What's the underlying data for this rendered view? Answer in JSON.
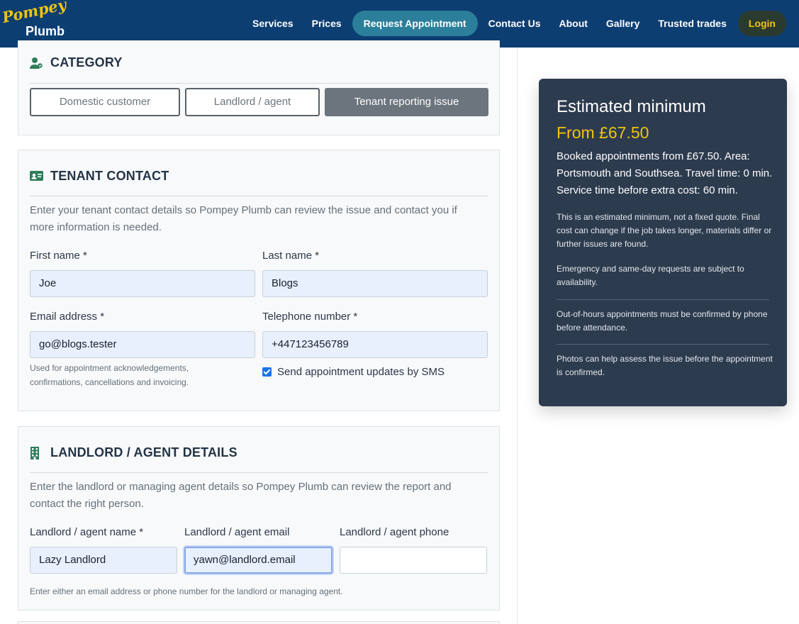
{
  "brand": {
    "logo_script": "Pompey",
    "logo_word": "Plumb"
  },
  "nav": {
    "services": "Services",
    "prices": "Prices",
    "request": "Request Appointment",
    "contact": "Contact Us",
    "about": "About",
    "gallery": "Gallery",
    "trusted": "Trusted trades",
    "login": "Login"
  },
  "category": {
    "title": "CATEGORY",
    "options": [
      "Domestic customer",
      "Landlord / agent",
      "Tenant reporting issue"
    ],
    "selected": "Tenant reporting issue"
  },
  "tenant": {
    "title": "TENANT CONTACT",
    "description": "Enter your tenant contact details so Pompey Plumb can review the issue and contact you if more information is needed.",
    "first_name_label": "First name *",
    "first_name": "Joe",
    "last_name_label": "Last name *",
    "last_name": "Blogs",
    "email_label": "Email address *",
    "email": "go@blogs.tester",
    "email_help": "Used for appointment acknowledgements, confirmations, cancellations and invoicing.",
    "phone_label": "Telephone number *",
    "phone": "+447123456789",
    "sms_label": "Send appointment updates by SMS",
    "sms_checked": true
  },
  "landlord": {
    "title": "LANDLORD / AGENT DETAILS",
    "description": "Enter the landlord or managing agent details so Pompey Plumb can review the report and contact the right person.",
    "name_label": "Landlord / agent name *",
    "name": "Lazy Landlord",
    "email_label": "Landlord / agent email",
    "email": "yawn@landlord.email",
    "phone_label": "Landlord / agent phone",
    "phone": "",
    "help": "Enter either an email address or phone number for the landlord or managing agent."
  },
  "estimate": {
    "heading": "Estimated minimum",
    "price": "From £67.50",
    "lead": "Booked appointments from £67.50. Area: Portsmouth and Southsea. Travel time: 0 min. Service time before extra cost: 60 min.",
    "note1": "This is an estimated minimum, not a fixed quote. Final cost can change if the job takes longer, materials differ or further issues are found.",
    "note2": "Emergency and same-day requests are subject to availability.",
    "note3": "Out-of-hours appointments must be confirmed by phone before attendance.",
    "note4": "Photos can help assess the issue before the appointment is confirmed."
  },
  "colors": {
    "header": "#0d3e72",
    "accent": "#f1c40f",
    "active_nav": "#2c7f9b",
    "sidebar": "#2d3b4e",
    "icon": "#2e7d5b"
  }
}
